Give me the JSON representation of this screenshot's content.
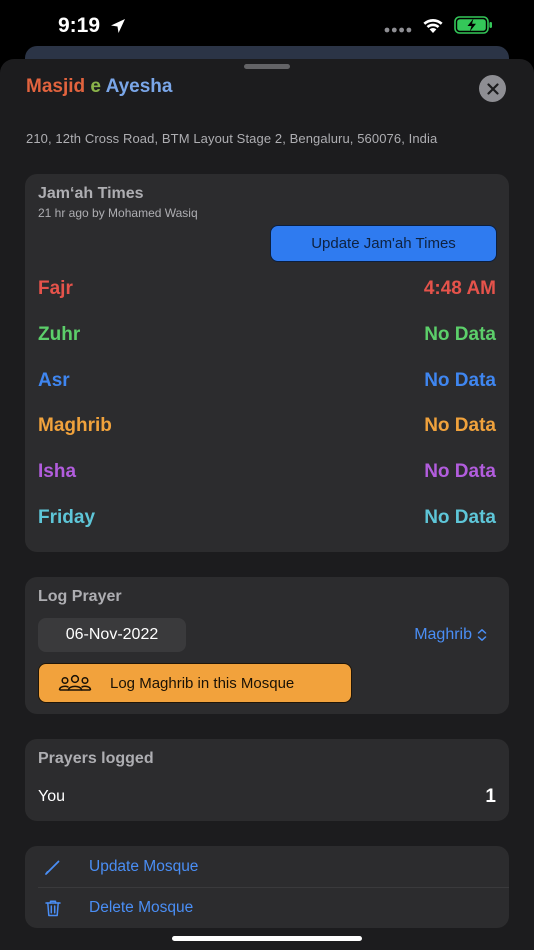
{
  "status_bar": {
    "time": "9:19",
    "icons": [
      "location-arrow-icon",
      "cellular-dots-icon",
      "wifi-icon",
      "battery-charging-icon"
    ]
  },
  "mosque": {
    "name_parts": [
      "Masjid",
      "e",
      "Ayesha"
    ],
    "address": "210, 12th Cross Road, BTM Layout Stage 2, Bengaluru, 560076, India"
  },
  "jamah": {
    "heading": "Jam‘ah Times",
    "subtitle": "21 hr ago by Mohamed Wasiq",
    "update_button": "Update Jam'ah Times",
    "prayers": [
      {
        "name": "Fajr",
        "time": "4:48 AM",
        "color": "#e5534b"
      },
      {
        "name": "Zuhr",
        "time": "No Data",
        "color": "#5ccf6a"
      },
      {
        "name": "Asr",
        "time": "No Data",
        "color": "#3f86f0"
      },
      {
        "name": "Maghrib",
        "time": "No Data",
        "color": "#f0a23c"
      },
      {
        "name": "Isha",
        "time": "No Data",
        "color": "#b25ddd"
      },
      {
        "name": "Friday",
        "time": "No Data",
        "color": "#5ec6d8"
      }
    ]
  },
  "log_prayer": {
    "heading": "Log Prayer",
    "date": "06-Nov-2022",
    "selected_prayer": "Maghrib",
    "log_button": "Log Maghrib in this Mosque"
  },
  "prayers_logged": {
    "heading": "Prayers logged",
    "rows": [
      {
        "label": "You",
        "count": "1"
      }
    ]
  },
  "actions": [
    {
      "label": "Update Mosque",
      "icon": "pencil-icon"
    },
    {
      "label": "Delete Mosque",
      "icon": "trash-icon"
    }
  ],
  "colors": {
    "accent_blue": "#4a8ef5",
    "button_blue": "#2f7bf0",
    "button_orange": "#f2a23c",
    "card_bg": "#2c2c2e",
    "sheet_bg": "#1c1c1e"
  }
}
